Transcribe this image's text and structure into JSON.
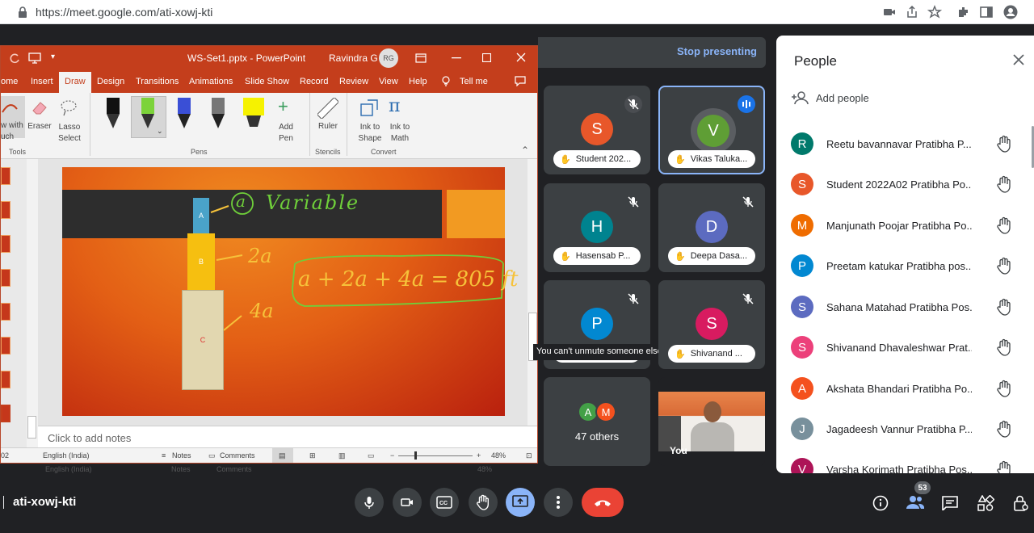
{
  "browser": {
    "url": "https://meet.google.com/ati-xowj-kti"
  },
  "meet": {
    "stop_presenting": "Stop presenting",
    "meeting_code": "ati-xowj-kti",
    "people_badge": "53",
    "mute_tooltip": "You can't unmute someone else"
  },
  "ppt": {
    "title": "WS-Set1.pptx  -  PowerPoint",
    "user_name": "Ravindra G",
    "user_initials": "RG",
    "tabs": [
      "ome",
      "Insert",
      "Draw",
      "Design",
      "Transitions",
      "Animations",
      "Slide Show",
      "Record",
      "Review",
      "View",
      "Help",
      "Tell me"
    ],
    "ribbon": {
      "draw_with_touch": "w with\nuch",
      "eraser": "Eraser",
      "lasso": "Lasso\nSelect",
      "add_pen": "Add\nPen",
      "ruler": "Ruler",
      "ink_to_shape": "Ink to\nShape",
      "ink_to_math": "Ink to\nMath",
      "groups": {
        "tools": "Tools",
        "pens": "Pens",
        "stencils": "Stencils",
        "convert": "Convert"
      }
    },
    "slide": {
      "box_a": "A",
      "box_b": "B",
      "box_c": "C",
      "ink_a": "a",
      "ink_variable": "Variable",
      "ink_2a": "2a",
      "ink_4a": "4a",
      "ink_equation": "a + 2a + 4a = 805 ft"
    },
    "notes_placeholder": "Click to add notes",
    "status": {
      "slide_no": "02",
      "language": "English (India)",
      "notes": "Notes",
      "comments": "Comments",
      "zoom": "48%"
    }
  },
  "tiles": [
    {
      "initial": "S",
      "name": "Student 202...",
      "color": "#e8572a"
    },
    {
      "initial": "V",
      "name": "Vikas Taluka...",
      "color": "#5f9e35"
    },
    {
      "initial": "H",
      "name": "Hasensab P...",
      "color": "#00838f"
    },
    {
      "initial": "D",
      "name": "Deepa Dasa...",
      "color": "#5c6bc0"
    },
    {
      "initial": "P",
      "name": "",
      "color": "#0288d1"
    },
    {
      "initial": "S",
      "name": "Shivanand ...",
      "color": "#d81b60"
    }
  ],
  "others": {
    "label": "47 others",
    "a1": "A",
    "a1_color": "#43a047",
    "a2": "M",
    "a2_color": "#f4511e"
  },
  "self_tile": {
    "label": "You"
  },
  "people_panel": {
    "title": "People",
    "add_people": "Add people",
    "participants": [
      {
        "initial": "R",
        "name": "Reetu bavannavar Pratibha P...",
        "color": "#00796b"
      },
      {
        "initial": "S",
        "name": "Student 2022A02 Pratibha Po...",
        "color": "#e8572a"
      },
      {
        "initial": "M",
        "name": "Manjunath Poojar Pratibha Po...",
        "color": "#ef6c00"
      },
      {
        "initial": "P",
        "name": "Preetam katukar Pratibha pos...",
        "color": "#0288d1"
      },
      {
        "initial": "S",
        "name": "Sahana Matahad Pratibha Pos...",
        "color": "#5c6bc0"
      },
      {
        "initial": "S",
        "name": "Shivanand Dhavaleshwar Prat...",
        "color": "#ec407a"
      },
      {
        "initial": "A",
        "name": "Akshata Bhandari Pratibha Po...",
        "color": "#f4511e"
      },
      {
        "initial": "J",
        "name": "Jagadeesh Vannur Pratibha P...",
        "color": "#78909c"
      },
      {
        "initial": "V",
        "name": "Varsha Korimath Pratibha Pos...",
        "color": "#ad1457"
      }
    ]
  },
  "colors": {
    "end_call": "#ea4335",
    "present_active": "#8ab4f8",
    "speaking_border": "#8ab4f8"
  }
}
